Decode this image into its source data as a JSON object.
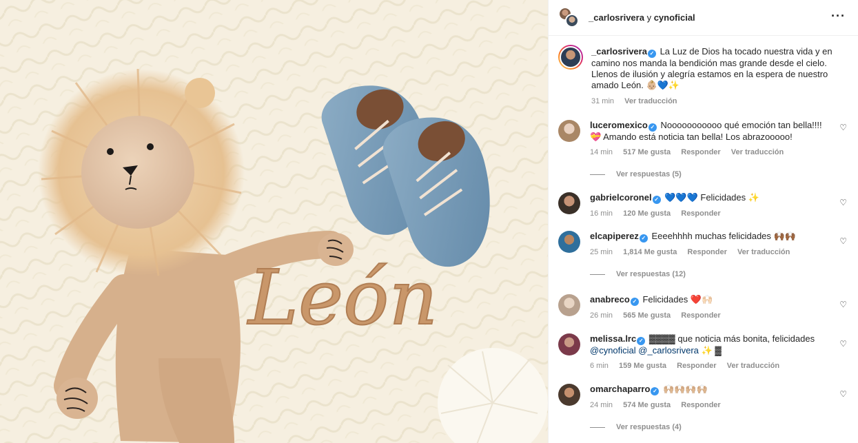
{
  "header": {
    "user1": "_carlosrivera",
    "joiner": "y",
    "user2": "cynoficial",
    "more_icon": "more-horizontal-icon"
  },
  "photo": {
    "embroidery_text": "León"
  },
  "caption": {
    "username": "_carlosrivera",
    "text": "La Luz de Dios ha tocado nuestra vida y en camino nos manda la bendición mas grande desde el cielo. Llenos de ilusión y alegría estamos en la espera de nuestro amado León.",
    "emoji": "👶🏼💙✨",
    "time": "31 min",
    "translate": "Ver traducción"
  },
  "comments": [
    {
      "username": "luceromexico",
      "text": "Nooooooooooo qué emoción tan bella!!!! 💝 Amando está noticia tan bella! Los abrazooooo!",
      "time": "14 min",
      "likes": "517 Me gusta",
      "reply": "Responder",
      "translate": "Ver traducción",
      "view_replies": "Ver respuestas (5)"
    },
    {
      "username": "gabrielcoronel",
      "text": "💙💙💙 Felicidades ✨",
      "time": "16 min",
      "likes": "120 Me gusta",
      "reply": "Responder"
    },
    {
      "username": "elcapiperez",
      "text": "Eeeehhhh muchas felicidades 🙌🏾🙌🏾",
      "time": "25 min",
      "likes": "1,814 Me gusta",
      "reply": "Responder",
      "translate": "Ver traducción",
      "view_replies": "Ver respuestas (12)"
    },
    {
      "username": "anabreco",
      "text": "Felicidades ❤️🙌🏻",
      "time": "26 min",
      "likes": "565 Me gusta",
      "reply": "Responder"
    },
    {
      "username": "melissa.lrc",
      "text_pre": "▓▓▓▓ que noticia más bonita, felicidades",
      "mention1": "@cynoficial",
      "mention2": "@_carlosrivera",
      "text_post": "✨ ▓",
      "time": "6 min",
      "likes": "159 Me gusta",
      "reply": "Responder",
      "translate": "Ver traducción"
    },
    {
      "username": "omarchaparro",
      "text": "🙌🏼🙌🏼🙌🏼🙌🏼",
      "time": "24 min",
      "likes": "574 Me gusta",
      "reply": "Responder",
      "view_replies": "Ver respuestas (4)"
    }
  ],
  "colors": {
    "verified": "#3897f0",
    "meta_text": "#8e8e8e",
    "mention": "#00376b"
  }
}
